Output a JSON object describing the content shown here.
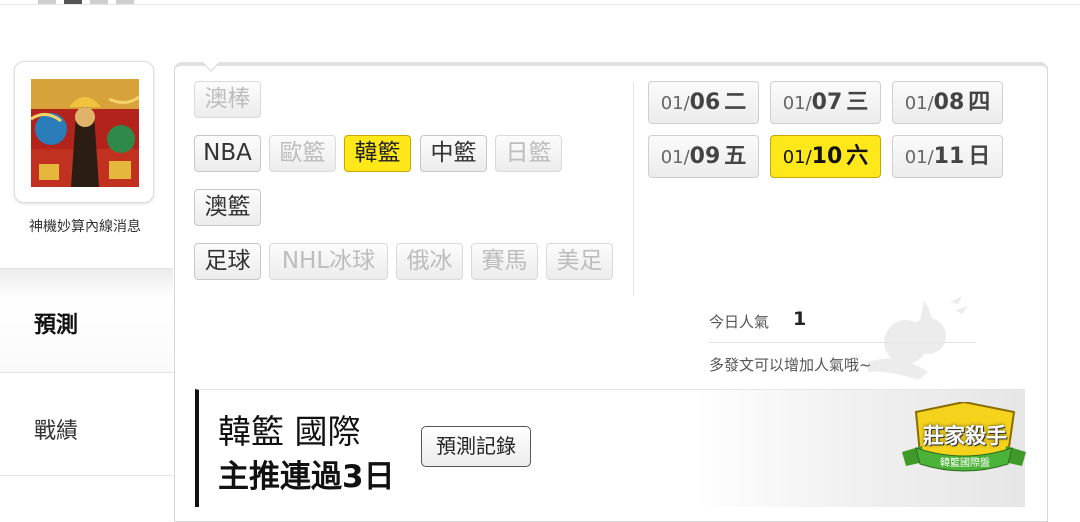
{
  "profile": {
    "caption": "神機妙算內線消息"
  },
  "side_tabs": {
    "predict": "預測",
    "record": "戰績"
  },
  "sports": [
    {
      "label": "澳棒",
      "state": "disabled"
    },
    {
      "label": "NBA",
      "state": "normal"
    },
    {
      "label": "歐籃",
      "state": "disabled"
    },
    {
      "label": "韓籃",
      "state": "selected"
    },
    {
      "label": "中籃",
      "state": "normal"
    },
    {
      "label": "日籃",
      "state": "disabled"
    },
    {
      "label": "澳籃",
      "state": "normal"
    },
    {
      "label": "足球",
      "state": "normal"
    },
    {
      "label": "NHL冰球",
      "state": "disabled"
    },
    {
      "label": "俄冰",
      "state": "disabled"
    },
    {
      "label": "賽馬",
      "state": "disabled"
    },
    {
      "label": "美足",
      "state": "disabled"
    }
  ],
  "dates": [
    {
      "md": "01/",
      "day": "06",
      "weekday": "二",
      "selected": false
    },
    {
      "md": "01/",
      "day": "07",
      "weekday": "三",
      "selected": false
    },
    {
      "md": "01/",
      "day": "08",
      "weekday": "四",
      "selected": false
    },
    {
      "md": "01/",
      "day": "09",
      "weekday": "五",
      "selected": false
    },
    {
      "md": "01/",
      "day": "10",
      "weekday": "六",
      "selected": true
    },
    {
      "md": "01/",
      "day": "11",
      "weekday": "日",
      "selected": false
    }
  ],
  "popularity": {
    "label": "今日人氣",
    "value": "1",
    "hint": "多發文可以增加人氣哦~"
  },
  "banner": {
    "league": "韓籃 國際",
    "streak": "主推連過3日",
    "history_button": "預測記錄",
    "badge_title": "莊家殺手",
    "badge_subtitle": "韓籃國際盤"
  },
  "colors": {
    "highlight": "#ffe819",
    "disabled_text": "#bdbdbd"
  }
}
